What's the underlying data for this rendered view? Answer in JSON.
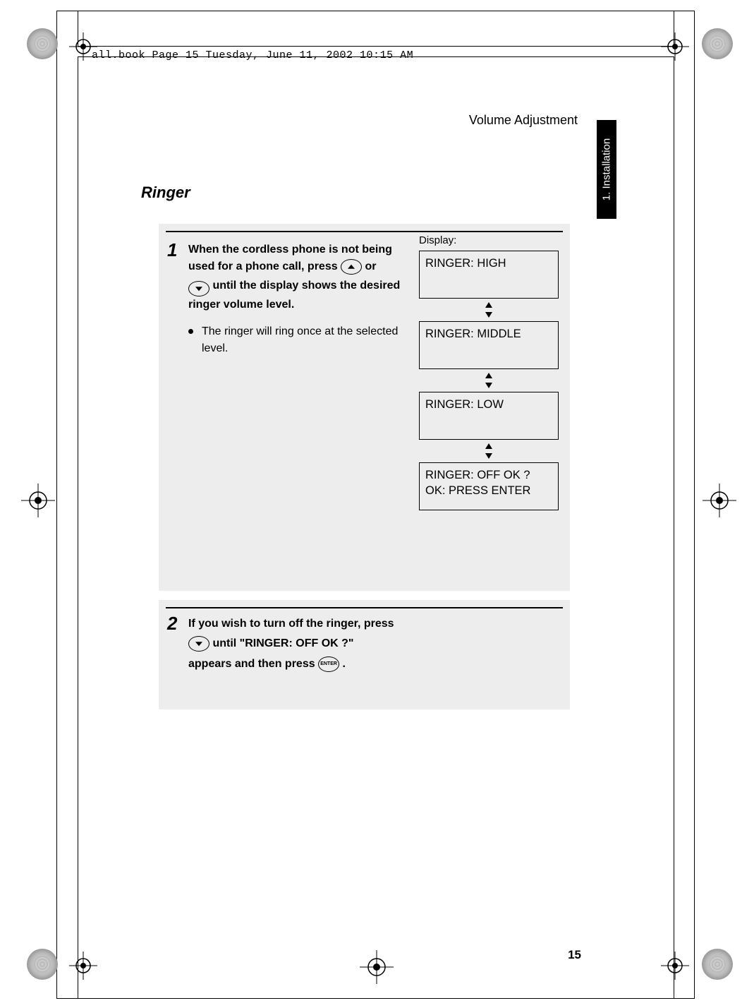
{
  "running_header": "all.book  Page 15  Tuesday, June 11, 2002  10:15 AM",
  "header_right": "Volume Adjustment",
  "side_tab": "1. Installation",
  "section_title": "Ringer",
  "step1": {
    "num": "1",
    "line1a": "When the cordless phone is not being ",
    "line1b": "used for a phone call, press ",
    "line1c": " or ",
    "line1d": " until the display shows the ",
    "line1e": "desired ringer volume level.",
    "bullet": "The ringer will ring once at the selected level."
  },
  "display_label": "Display:",
  "displays": {
    "d1": "RINGER: HIGH",
    "d2": "RINGER: MIDDLE",
    "d3": "RINGER: LOW",
    "d4a": "RINGER: OFF OK ?",
    "d4b": "OK: PRESS ENTER"
  },
  "step2": {
    "num": "2",
    "line1a": "If you wish to turn off the ringer, press ",
    "line1b": " until \"RINGER: OFF OK ?\" ",
    "line1c": "appears and then press ",
    "line1d": "."
  },
  "enter_label": "ENTER",
  "page_number": "15"
}
